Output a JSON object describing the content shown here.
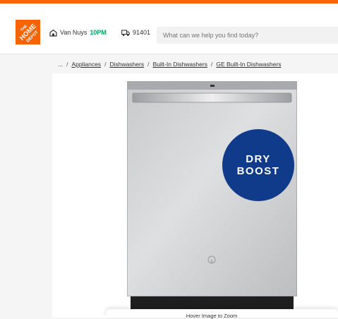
{
  "header": {
    "logo_text": "THE HOME DEPOT",
    "store_name": "Van Nuys",
    "store_hours": "10PM",
    "zip": "91401",
    "search_placeholder": "What can we help you find today?"
  },
  "breadcrumbs": {
    "ellipsis": "...",
    "items": [
      "Appliances",
      "Dishwashers",
      "Built-In Dishwashers",
      "GE Built-In Dishwashers"
    ]
  },
  "product": {
    "badge_line1": "DRY",
    "badge_line2": "BOOST",
    "zoom_hint": "Hover Image to Zoom"
  },
  "colors": {
    "brand": "#f96302",
    "open_green": "#00a35b",
    "badge_blue": "#0f3b8a"
  },
  "icons": {
    "store": "store-icon",
    "delivery": "truck-icon"
  }
}
